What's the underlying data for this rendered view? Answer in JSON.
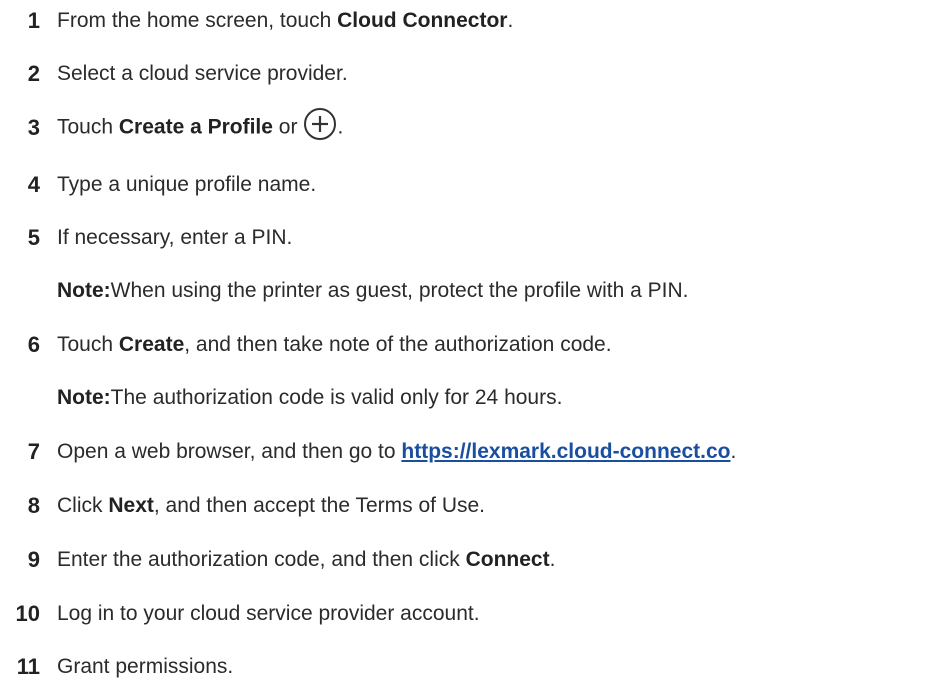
{
  "steps": [
    {
      "num": "1",
      "pre": "From the home screen, touch ",
      "bold": "Cloud Connector",
      "post": "."
    },
    {
      "num": "2",
      "text": "Select a cloud service provider."
    },
    {
      "num": "3",
      "pre": "Touch ",
      "bold": "Create a Profile",
      "mid": " or",
      "post": "."
    },
    {
      "num": "4",
      "text": "Type a unique profile name."
    },
    {
      "num": "5",
      "text": "If necessary, enter a PIN."
    },
    {
      "note_label": "Note:",
      "note_text": " When using the printer as guest, protect the profile with a PIN."
    },
    {
      "num": "6",
      "pre": "Touch ",
      "bold": "Create",
      "post": ", and then take note of the authorization code."
    },
    {
      "note_label": "Note:",
      "note_text": " The authorization code is valid only for 24 hours."
    },
    {
      "num": "7",
      "pre": "Open a web browser, and then go to ",
      "link": "https://lexmark.cloud-connect.co",
      "post": "."
    },
    {
      "num": "8",
      "pre": "Click ",
      "bold": "Next",
      "post": ", and then accept the Terms of Use."
    },
    {
      "num": "9",
      "pre": "Enter the authorization code, and then click ",
      "bold": "Connect",
      "post": "."
    },
    {
      "num": "10",
      "text": "Log in to your cloud service provider account."
    },
    {
      "num": "11",
      "text": "Grant permissions."
    }
  ],
  "icons": {
    "add": "plus-circle-icon"
  }
}
